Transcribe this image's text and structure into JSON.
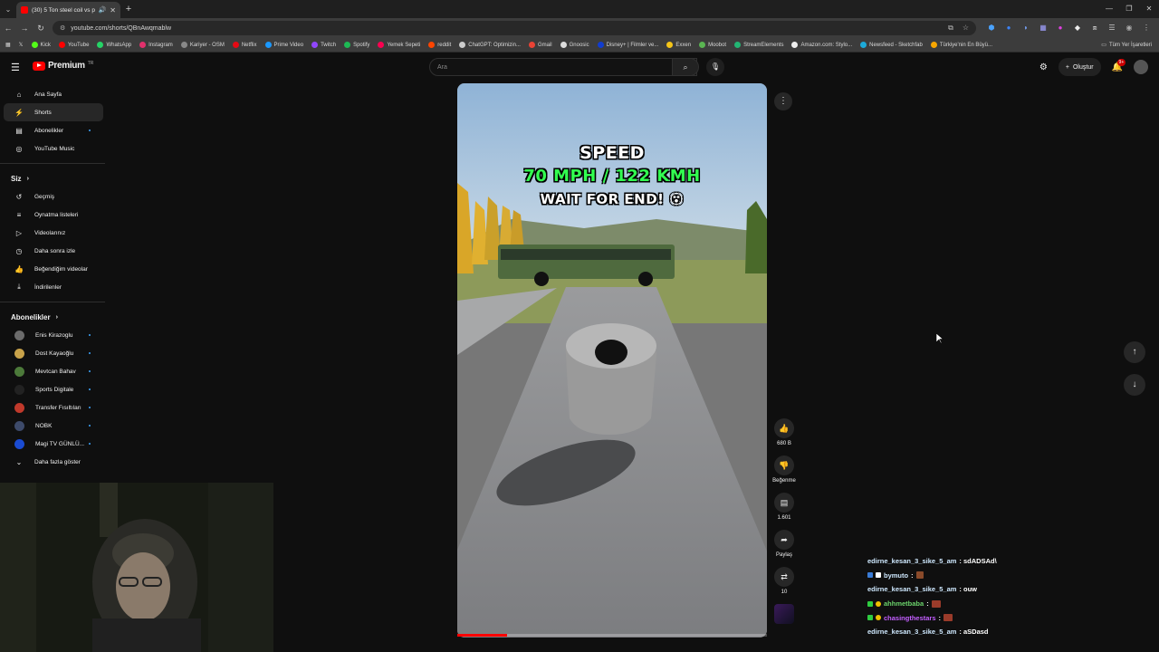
{
  "browser": {
    "tab_title": "(30) 5 Ton steel coil vs puli",
    "url": "youtube.com/shorts/QBnAwqmablw",
    "bookmarks": [
      "Kick",
      "YouTube",
      "WhatsApp",
      "Instagram",
      "Kariyer - OSM",
      "Netflix",
      "Prime Video",
      "Twitch",
      "Spotify",
      "Yemek Sepeti",
      "reddit",
      "ChatGPT: Optimizin...",
      "Gmail",
      "Gnoosic",
      "Disney+ | Filmler ve...",
      "Exxen",
      "Moobot",
      "StreamElements",
      "Amazon.com: Stylo...",
      "Newsfeed - Sketchfab",
      "Türkiye'nin En Büyü..."
    ],
    "bookmarks_right": "Tüm Yer İşaretleri"
  },
  "header": {
    "logo_text": "Premium",
    "logo_tr": "TR",
    "search_placeholder": "Ara",
    "create_label": "Oluştur",
    "notif_count": "9+"
  },
  "sidebar": {
    "main": [
      {
        "label": "Ana Sayfa",
        "icon": "home-icon"
      },
      {
        "label": "Shorts",
        "icon": "shorts-icon"
      },
      {
        "label": "Abonelikler",
        "icon": "subscriptions-icon"
      },
      {
        "label": "YouTube Music",
        "icon": "music-icon"
      }
    ],
    "you_title": "Siz",
    "you": [
      {
        "label": "Geçmiş",
        "icon": "history-icon"
      },
      {
        "label": "Oynatma listeleri",
        "icon": "playlists-icon"
      },
      {
        "label": "Videolarınız",
        "icon": "your-videos-icon"
      },
      {
        "label": "Daha sonra izle",
        "icon": "watch-later-icon"
      },
      {
        "label": "Beğendiğim videolar",
        "icon": "liked-icon"
      },
      {
        "label": "İndirilenler",
        "icon": "downloads-icon"
      }
    ],
    "subs_title": "Abonelikler",
    "subs": [
      {
        "label": "Enis Kirazoglu",
        "color": "#6b6b6b"
      },
      {
        "label": "Dost Kayaoğlu",
        "color": "#c8a24a"
      },
      {
        "label": "Mevtcan Bahav",
        "color": "#4c7a3a"
      },
      {
        "label": "Sports Digitale",
        "color": "#222222"
      },
      {
        "label": "Transfer Fısıltıları",
        "color": "#c0392b"
      },
      {
        "label": "NOBK",
        "color": "#3d4a6a"
      },
      {
        "label": "Magi TV GÜNLÜ...",
        "color": "#1a4bd1"
      }
    ],
    "show_more": "Daha fazla göster"
  },
  "video": {
    "overlay_line1": "SPEED",
    "overlay_line2": "70 MPH / 122 KMH",
    "overlay_line3": "WAIT FOR END! 😵",
    "progress": 0.16
  },
  "actions": {
    "like_count": "680 B",
    "dislike_label": "Beğenme",
    "comment_count": "1.601",
    "share_label": "Paylaş",
    "remix_count": "10"
  },
  "chat": [
    {
      "user": "edirne_kesan_3_sike_5_am",
      "msg": ": sdADSAd\\",
      "user_color": "#cfe9ff",
      "badges": []
    },
    {
      "user": "bymuto",
      "msg": ":",
      "user_color": "#cfe9ff",
      "badges": [
        "#3a7bd5",
        "#ffffff"
      ],
      "emote": "#8a4a2a"
    },
    {
      "user": "edirne_kesan_3_sike_5_am",
      "msg": ": ouw",
      "user_color": "#cfe9ff",
      "badges": []
    },
    {
      "user": "ahhmetbaba",
      "msg": ":",
      "user_color": "#6bd36b",
      "badges": [
        "#2ecc40",
        "#f0c000"
      ],
      "emote": "#9a3b2a"
    },
    {
      "user": "chasingthestars",
      "msg": ":",
      "user_color": "#c45fff",
      "badges": [
        "#2ecc40",
        "#f0c000"
      ],
      "emote": "#9a3b2a"
    },
    {
      "user": "edirne_kesan_3_sike_5_am",
      "msg": ": aSDasd",
      "user_color": "#cfe9ff",
      "badges": []
    }
  ]
}
